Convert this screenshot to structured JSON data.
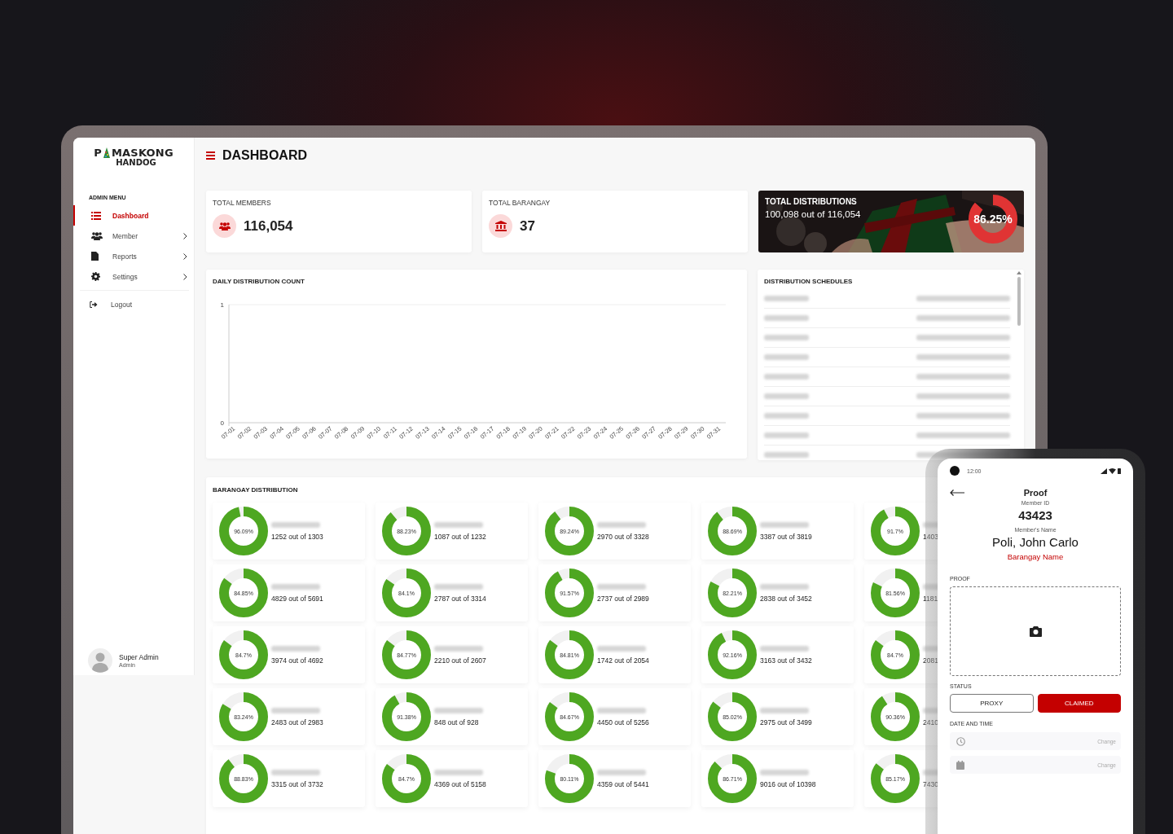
{
  "logo": {
    "line1_left": "P",
    "line1_right": "MASKONG",
    "line2": "HANDOG"
  },
  "page_title": "DASHBOARD",
  "sidebar": {
    "heading": "ADMIN MENU",
    "items": [
      {
        "label": "Dashboard",
        "selected": true,
        "submenu": false
      },
      {
        "label": "Member",
        "selected": false,
        "submenu": true
      },
      {
        "label": "Reports",
        "selected": false,
        "submenu": true
      },
      {
        "label": "Settings",
        "selected": false,
        "submenu": true
      }
    ],
    "logout": {
      "label": "Logout"
    },
    "user": {
      "name": "Super Admin",
      "role": "Admin"
    }
  },
  "stats": [
    {
      "kind": "plain",
      "label": "TOTAL MEMBERS",
      "value": "116,054"
    },
    {
      "kind": "plain",
      "label": "TOTAL BARANGAY",
      "value": "37"
    },
    {
      "label": "TOTAL DISTRIBUTIONS",
      "value": "100,098 out of 116,054",
      "percent": "86.25%",
      "level": 0.8625
    }
  ],
  "daily_chart": {
    "title": "DAILY DISTRIBUTION COUNT",
    "chart_data": {
      "type": "line",
      "categories": [
        "07-01",
        "07-02",
        "07-03",
        "07-04",
        "07-05",
        "07-06",
        "07-07",
        "07-08",
        "07-09",
        "07-10",
        "07-11",
        "07-12",
        "07-13",
        "07-14",
        "07-15",
        "07-16",
        "07-17",
        "07-18",
        "07-19",
        "07-20",
        "07-21",
        "07-22",
        "07-23",
        "07-24",
        "07-25",
        "07-26",
        "07-27",
        "07-28",
        "07-29",
        "07-30",
        "07-31"
      ],
      "ylim": [
        0,
        1
      ],
      "yticks": [
        0,
        1
      ]
    }
  },
  "schedules": {
    "title": "DISTRIBUTION SCHEDULES",
    "rows": [
      {
        "blurred": true
      },
      {
        "blurred": true
      },
      {
        "blurred": true
      },
      {
        "blurred": true
      },
      {
        "blurred": true
      },
      {
        "blurred": true
      },
      {
        "blurred": true
      },
      {
        "blurred": true
      },
      {
        "blurred": true
      }
    ]
  },
  "barangays": {
    "title": "BARANGAY DISTRIBUTION",
    "cards": [
      {
        "percent": "96.09%",
        "count": "1252 out of 1303",
        "level": 0.9609,
        "name_blurred": true
      },
      {
        "percent": "88.23%",
        "count": "1087 out of 1232",
        "level": 0.8823,
        "name_blurred": true
      },
      {
        "percent": "89.24%",
        "count": "2970 out of 3328",
        "level": 0.8924,
        "name_blurred": true
      },
      {
        "percent": "88.69%",
        "count": "3387 out of 3819",
        "level": 0.8869,
        "name_blurred": true
      },
      {
        "percent": "91.7%",
        "count": "1403",
        "level": 0.917,
        "name_blurred": true
      },
      {
        "percent": "84.85%",
        "count": "4829 out of 5691",
        "level": 0.8485,
        "name_blurred": true
      },
      {
        "percent": "84.1%",
        "count": "2787 out of 3314",
        "level": 0.841,
        "name_blurred": true
      },
      {
        "percent": "91.57%",
        "count": "2737 out of 2989",
        "level": 0.9157,
        "name_blurred": true
      },
      {
        "percent": "82.21%",
        "count": "2838 out of 3452",
        "level": 0.8221,
        "name_blurred": true
      },
      {
        "percent": "81.56%",
        "count": "1181",
        "level": 0.8156,
        "name_blurred": true
      },
      {
        "percent": "84.7%",
        "count": "3974 out of 4692",
        "level": 0.847,
        "name_blurred": true
      },
      {
        "percent": "84.77%",
        "count": "2210 out of 2607",
        "level": 0.8477,
        "name_blurred": true
      },
      {
        "percent": "84.81%",
        "count": "1742 out of 2054",
        "level": 0.8481,
        "name_blurred": true
      },
      {
        "percent": "92.16%",
        "count": "3163 out of 3432",
        "level": 0.9216,
        "name_blurred": true
      },
      {
        "percent": "84.7%",
        "count": "2081",
        "level": 0.847,
        "name_blurred": true
      },
      {
        "percent": "83.24%",
        "count": "2483 out of 2983",
        "level": 0.8324,
        "name_blurred": true
      },
      {
        "percent": "91.38%",
        "count": "848 out of 928",
        "level": 0.9138,
        "name_blurred": true
      },
      {
        "percent": "84.67%",
        "count": "4450 out of 5256",
        "level": 0.8467,
        "name_blurred": true
      },
      {
        "percent": "85.02%",
        "count": "2975 out of 3499",
        "level": 0.8502,
        "name_blurred": true
      },
      {
        "percent": "90.36%",
        "count": "2410",
        "level": 0.9036,
        "name_blurred": true
      },
      {
        "percent": "88.83%",
        "count": "3315 out of 3732",
        "level": 0.8883,
        "name_blurred": true
      },
      {
        "percent": "84.7%",
        "count": "4369 out of 5158",
        "level": 0.847,
        "name_blurred": true
      },
      {
        "percent": "80.11%",
        "count": "4359 out of 5441",
        "level": 0.8011,
        "name_blurred": true
      },
      {
        "percent": "86.71%",
        "count": "9016 out of 10398",
        "level": 0.8671,
        "name_blurred": true
      },
      {
        "percent": "85.17%",
        "count": "7430",
        "level": 0.8517,
        "name_blurred": true
      }
    ]
  },
  "phone": {
    "time": "12:00",
    "title": "Proof",
    "member_id_label": "Member ID",
    "member_id": "43423",
    "name_label": "Member's Name",
    "name": "Poli, John Carlo",
    "barangay": "Barangay Name",
    "proof_label": "PROOF",
    "status_label": "STATUS",
    "status_options": [
      {
        "label": "PROXY",
        "selected": false
      },
      {
        "label": "CLAIMED",
        "selected": true
      }
    ],
    "datetime_label": "DATE AND TIME",
    "datetime_rows": [
      {
        "kind": "time",
        "action": "Change"
      },
      {
        "kind": "date",
        "action": "Change"
      }
    ]
  }
}
